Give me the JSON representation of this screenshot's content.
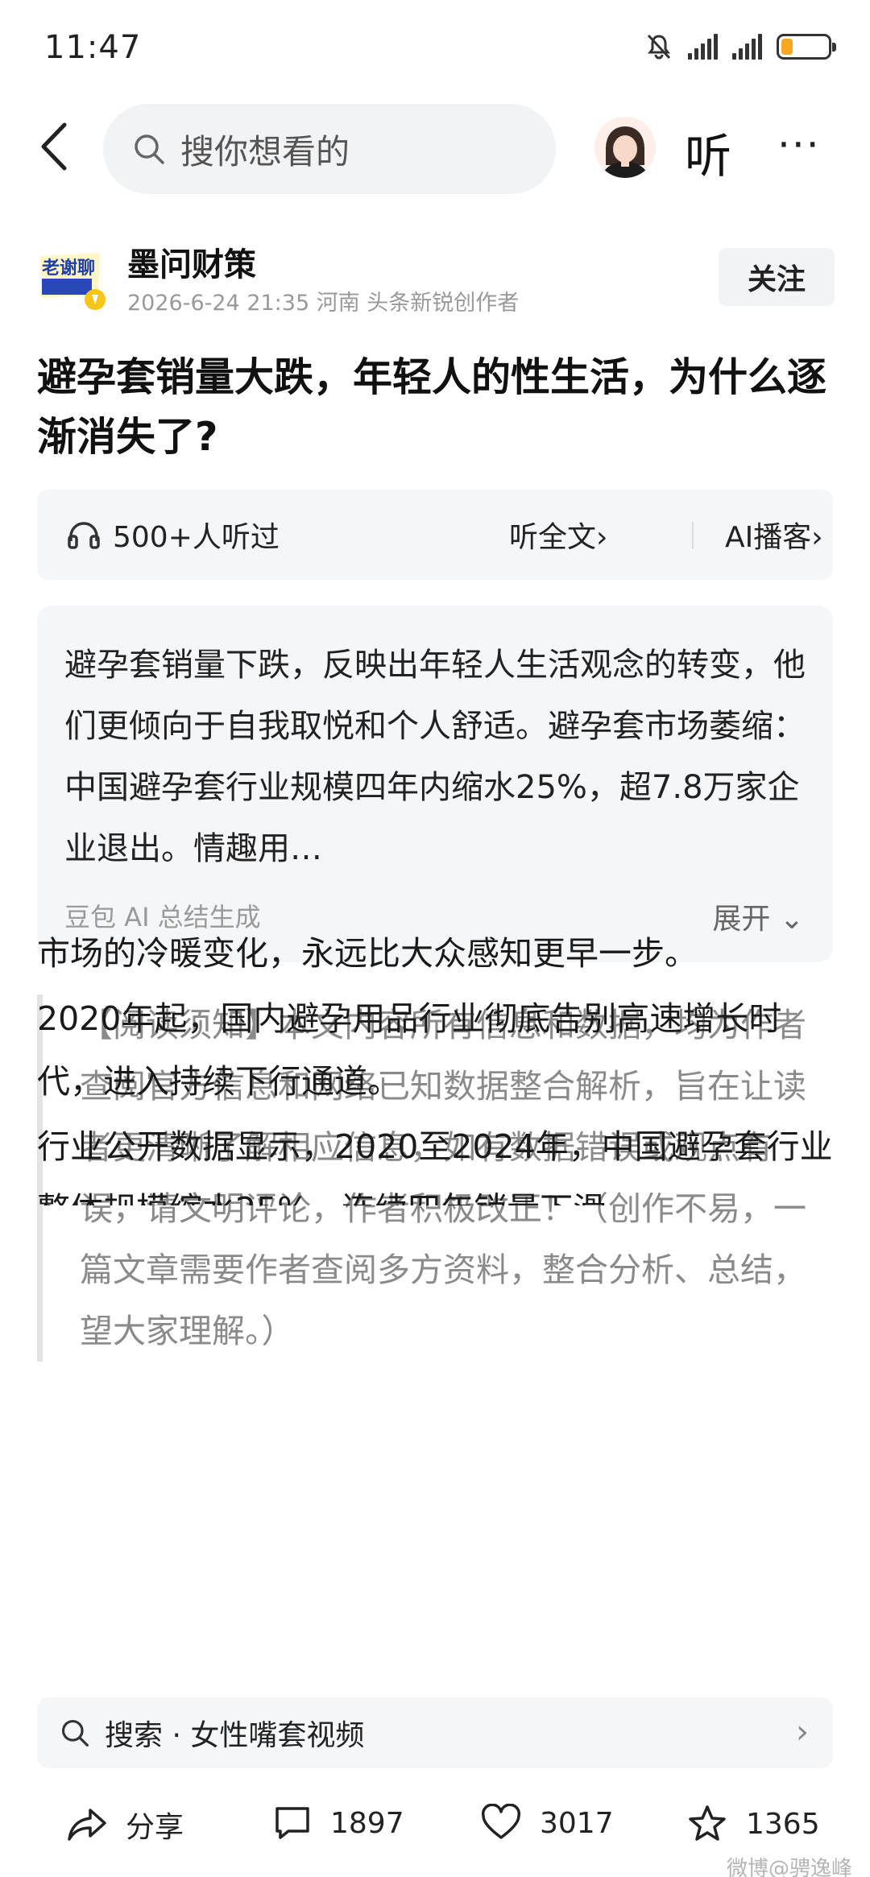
{
  "status_bar": {
    "time": "11:47"
  },
  "header": {
    "search_placeholder": "搜你想看的",
    "listen_label": "听",
    "more_label": "···"
  },
  "author": {
    "logo_text": "老谢聊",
    "name": "墨问财策",
    "meta": "2026-6-24  21:35  河南  头条新锐创作者",
    "follow_label": "关注"
  },
  "article": {
    "title": "避孕套销量大跌，年轻人的性生活，为什么逐渐消失了?"
  },
  "listen_bar": {
    "count_label": "500+人听过",
    "full_text_label": "听全文›",
    "ai_podcast_label": "AI播客›"
  },
  "summary": {
    "text": "避孕套销量下跌，反映出年轻人生活观念的转变，他们更倾向于自我取悦和个人舒适。避孕套市场萎缩：中国避孕套行业规模四年内缩水25%，超7.8万家企业退出。情趣用…",
    "source": "豆包 AI 总结生成",
    "expand_label": "展开 ⌄"
  },
  "notice": {
    "text": "【阅读须知】本文内容所有信息和数据，均为作者查阅官方信息和网络已知数据整合解析，旨在让读者更清晰了解相应信息，如有数据错误或观点有误，请文明评论，作者积极改正！（创作不易，一篇文章需要作者查阅多方资料，整合分析、总结，望大家理解。）"
  },
  "body": {
    "p1": "市场的冷暖变化，永远比大众感知更早一步。",
    "p2": "2020年起，国内避孕用品行业彻底告别高速增长时代，进入持续下行通道。",
    "p3": "行业公开数据显示，2020至2024年，中国避孕套行业整体规模缩水25%，连续四年销量下滑"
  },
  "related_search": {
    "text": "搜索 · 女性嘴套视频"
  },
  "bottom_bar": {
    "share_label": "分享",
    "comments": "1897",
    "likes": "3017",
    "favorites": "1365"
  },
  "watermark": "微博@骋逸峰",
  "colors": {
    "accent_yellow": "#f5c518",
    "battery": "#f5a623",
    "bg_card": "#f5f6f8"
  }
}
